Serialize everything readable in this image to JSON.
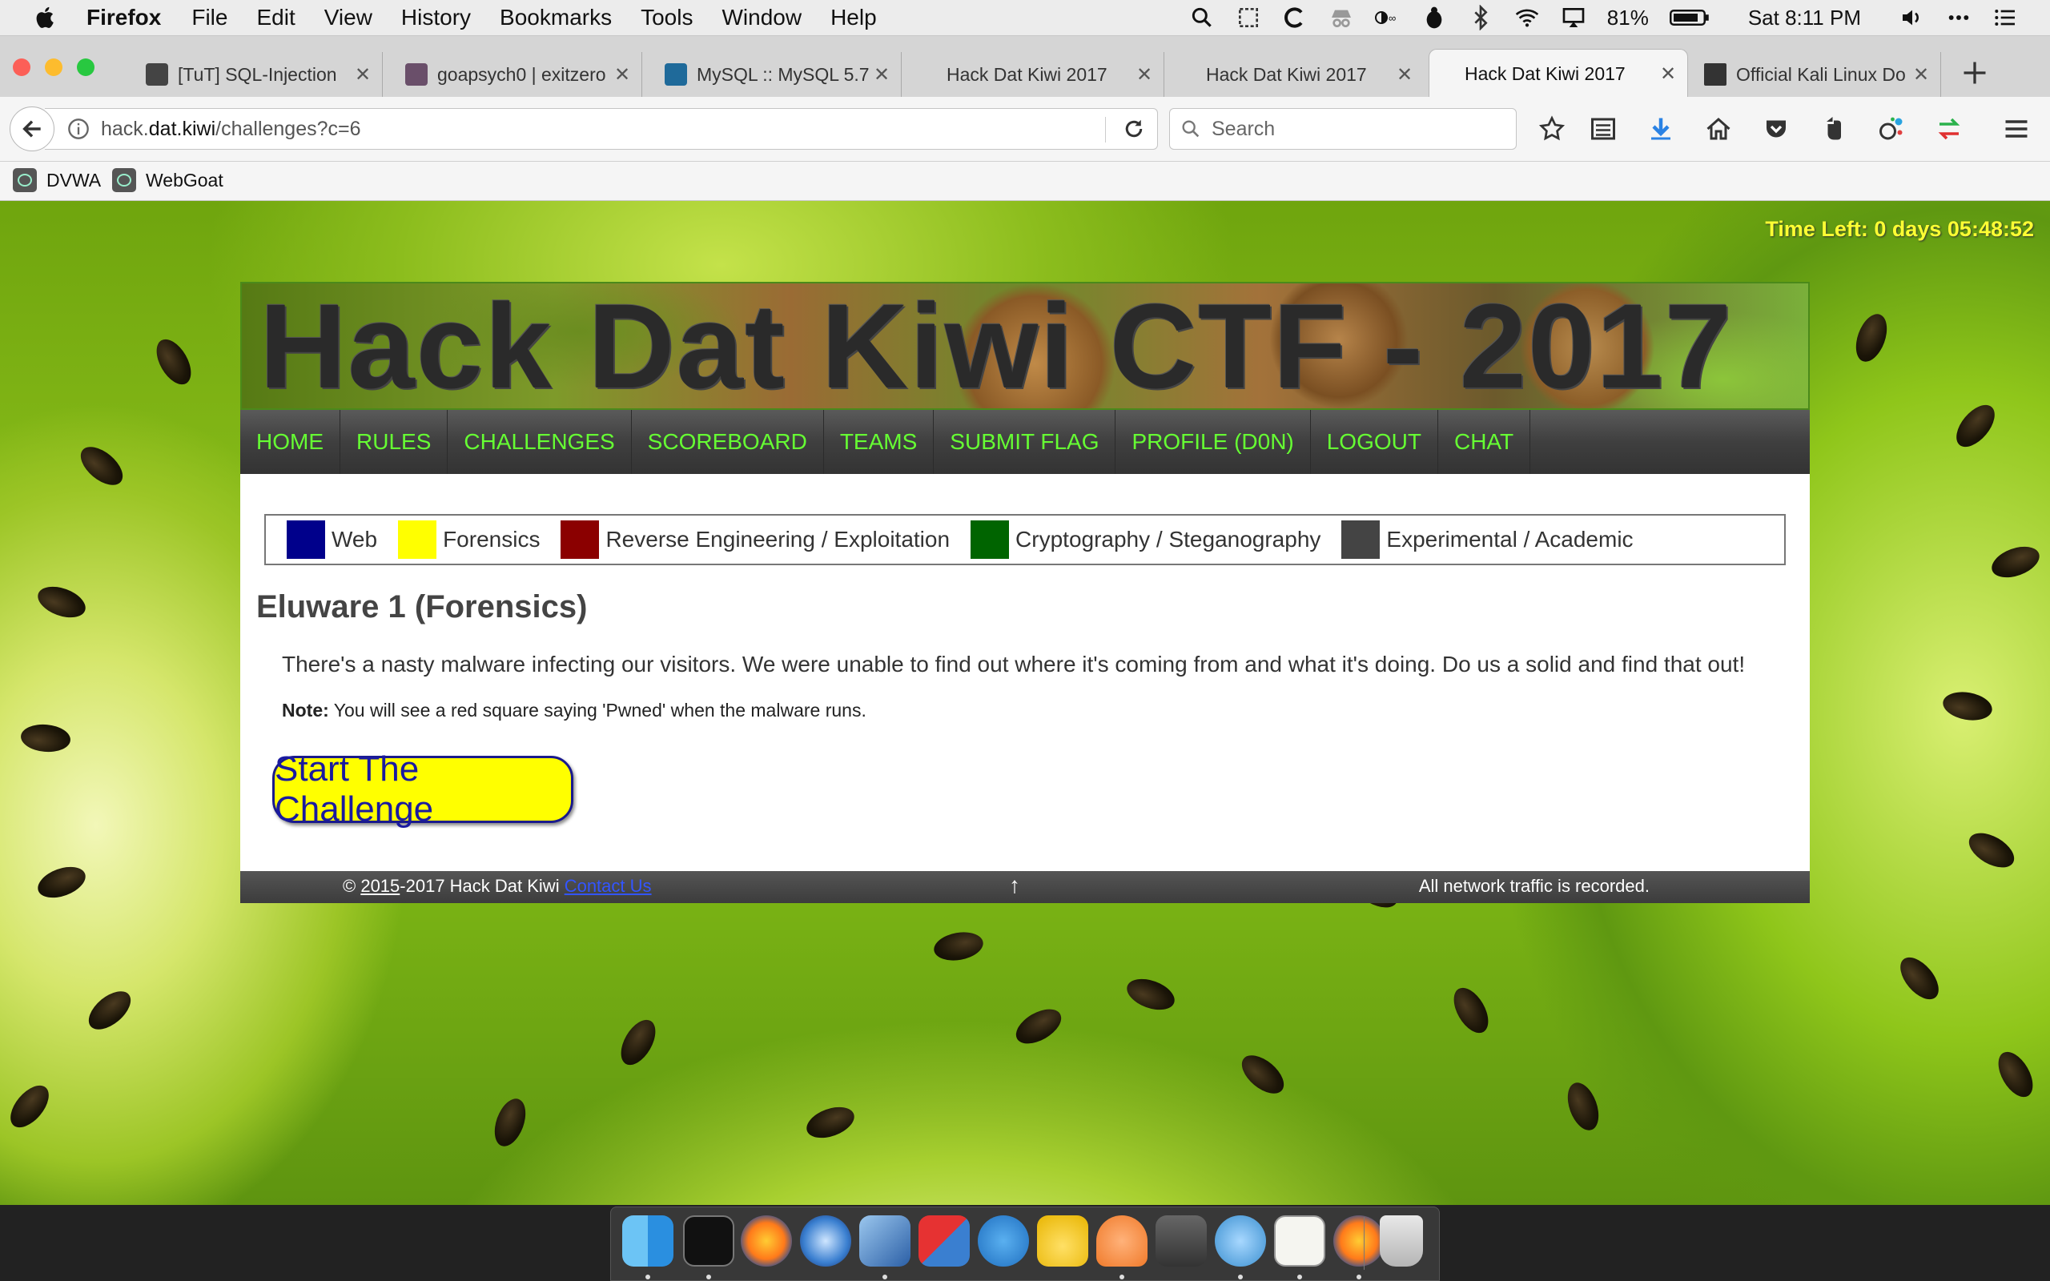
{
  "menubar": {
    "app_name": "Firefox",
    "items": [
      "File",
      "Edit",
      "View",
      "History",
      "Bookmarks",
      "Tools",
      "Window",
      "Help"
    ],
    "battery": "81%",
    "clock": "Sat 8:11 PM"
  },
  "tabs": [
    {
      "label": "[TuT] SQL-Injection",
      "favicon": "github-icon",
      "active": false
    },
    {
      "label": "goapsych0 | exitzero",
      "favicon": "slack-hash-icon",
      "active": false
    },
    {
      "label": "MySQL :: MySQL 5.7",
      "favicon": "mysql-icon",
      "active": false
    },
    {
      "label": "Hack Dat Kiwi 2017",
      "favicon": "",
      "active": false
    },
    {
      "label": "Hack Dat Kiwi 2017",
      "favicon": "",
      "active": false
    },
    {
      "label": "Hack Dat Kiwi 2017",
      "favicon": "",
      "active": true
    },
    {
      "label": "Official Kali Linux Do",
      "favicon": "kali-dragon-icon",
      "active": false
    }
  ],
  "urlbar": {
    "url_prefix": "hack.",
    "url_domain": "dat.kiwi",
    "url_path": "/challenges?c=6"
  },
  "searchbar": {
    "placeholder": "Search"
  },
  "bookmarks": [
    {
      "label": "DVWA"
    },
    {
      "label": "WebGoat"
    }
  ],
  "page": {
    "time_left": "Time Left: 0 days 05:48:52",
    "site_title": "Hack Dat Kiwi CTF - 2017",
    "nav": [
      "HOME",
      "RULES",
      "CHALLENGES",
      "SCOREBOARD",
      "TEAMS",
      "SUBMIT FLAG",
      "PROFILE (D0N)",
      "LOGOUT",
      "CHAT"
    ],
    "legend": [
      {
        "label": "Web",
        "color": "#00008b"
      },
      {
        "label": "Forensics",
        "color": "#ffff00"
      },
      {
        "label": "Reverse Engineering / Exploitation",
        "color": "#8b0000"
      },
      {
        "label": "Cryptography / Steganography",
        "color": "#006400"
      },
      {
        "label": "Experimental / Academic",
        "color": "#444444"
      }
    ],
    "challenge_title": "Eluware 1 (Forensics)",
    "challenge_desc": "There's a nasty malware infecting our visitors. We were unable to find out where it's coming from and what it's doing. Do us a solid and find that out!",
    "note_label": "Note:",
    "note_text": " You will see a red square saying 'Pwned' when the malware runs.",
    "start_button": "Start The Challenge",
    "footer": {
      "copy_symbol": "© ",
      "year_start": "2015",
      "copy_rest": "-2017 Hack Dat Kiwi ",
      "contact": "Contact Us",
      "arrow": "↑",
      "notice": "All network traffic is recorded."
    }
  },
  "dock": [
    "finder-icon",
    "terminal-icon",
    "firefox-icon",
    "thunderbird-icon",
    "virtualbox-icon",
    "parallels-icon",
    "docker-icon",
    "cyberduck-icon",
    "burp-icon",
    "sublime-icon",
    "mastodon-icon",
    "textedit-icon",
    "firefox-icon",
    "trash-icon"
  ]
}
